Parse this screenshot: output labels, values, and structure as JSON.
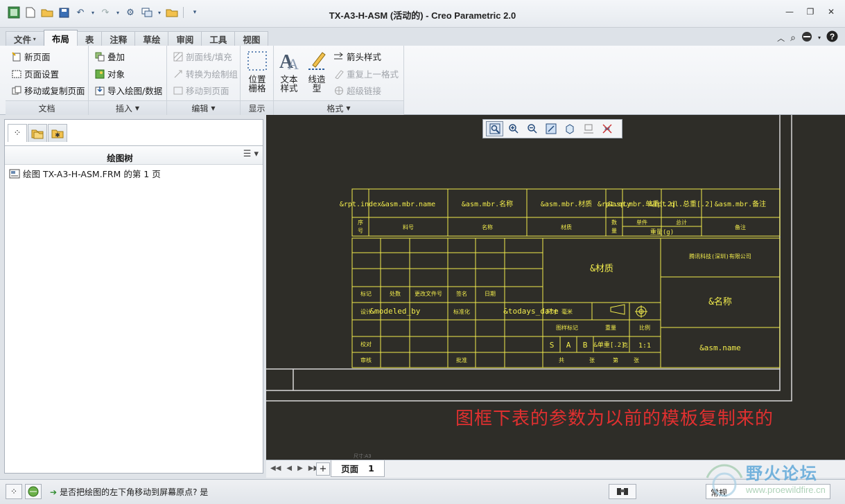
{
  "window": {
    "title": "TX-A3-H-ASM (活动的) - Creo Parametric 2.0"
  },
  "tabs": [
    "文件",
    "布局",
    "表",
    "注释",
    "草绘",
    "审阅",
    "工具",
    "视图"
  ],
  "active_tab": "布局",
  "ribbon": {
    "doc": {
      "label": "文档",
      "items": [
        "新页面",
        "页面设置",
        "移动或复制页面"
      ]
    },
    "insert": {
      "label": "插入",
      "items": [
        "叠加",
        "对象",
        "导入绘图/数据"
      ]
    },
    "edit": {
      "label": "编辑",
      "items": [
        "剖面线/填充",
        "转换为绘制组",
        "移动到页面"
      ]
    },
    "display": {
      "label": "显示",
      "grid_label_1": "位置",
      "grid_label_2": "栅格"
    },
    "format": {
      "label": "格式",
      "text_style_1": "文本",
      "text_style_2": "样式",
      "line_style_1": "线造",
      "line_style_2": "型",
      "items": [
        "箭头样式",
        "重复上一格式",
        "超级链接"
      ]
    }
  },
  "left_panel": {
    "tree_title": "绘图树",
    "tree_item": "绘图 TX-A3-H-ASM.FRM 的第 1 页"
  },
  "drawing": {
    "bom_params": [
      "&rpt.index",
      "&asm.mbr.name",
      "&asm.mbr.名称",
      "&asm.mbr.材质",
      "&rpt.qty",
      "&asm.mbr.单重[.2]",
      "&rpt.ql.总重[.2]",
      "&asm.mbr.备注"
    ],
    "bom_headers": [
      "序号",
      "料号",
      "名称",
      "材质",
      "数量",
      "单件",
      "总计",
      "重量(g)",
      "备注"
    ],
    "company": "腾讯科技(深圳)有限公司",
    "material": "&材质",
    "part_name": "&名称",
    "asm_name": "&asm.name",
    "rev_headers": [
      "标记",
      "处数",
      "更改文件号",
      "签名",
      "日期"
    ],
    "designer_label": "设计",
    "designer": "&modeled_by",
    "std_label": "标准化",
    "date": "&todays_date",
    "unit_label": "尺寸",
    "unit_value": "毫米",
    "stage_label": "图样标记",
    "weight_label": "重量",
    "scale_label": "比例",
    "stage_marks": [
      "S",
      "A",
      "B"
    ],
    "weight_value": "&单重[.2]",
    "weight_unit": "克",
    "scale_value": "1:1",
    "check_label": "校对",
    "review_label": "审核",
    "approve_label": "批准",
    "sheet_text": [
      "共",
      "张",
      "第",
      "张"
    ],
    "frame_small": "尺寸:A3"
  },
  "annotation": "图框下表的参数为以前的模板复制来的",
  "page_tab": {
    "label": "页面",
    "number": "1"
  },
  "status": {
    "message": "是否把绘图的左下角移动到屏幕原点?  是",
    "filter": "常规"
  },
  "watermark": {
    "name": "野火论坛",
    "url": "www.proewildfire.cn"
  },
  "colors": {
    "drawing_bg": "#2e2d28",
    "drawing_line": "#f2ec4c",
    "frame_line": "#ffffff",
    "annotation": "#e03030",
    "accent": "#2c5e9e"
  }
}
